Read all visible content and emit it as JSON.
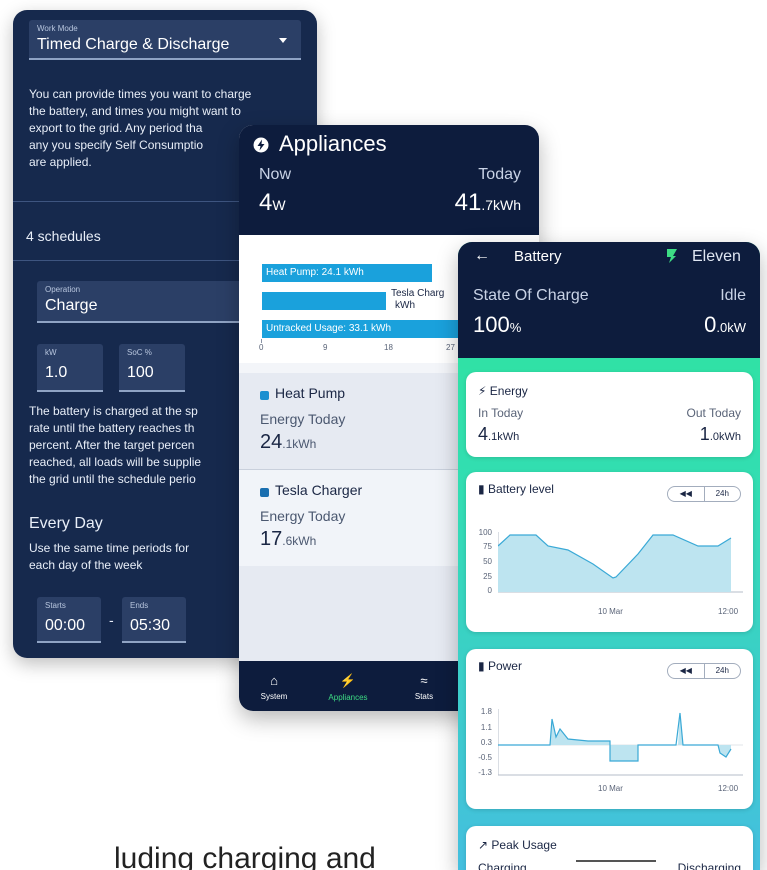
{
  "work_mode": {
    "mode_label": "Work Mode",
    "mode_value": "Timed Charge & Discharge",
    "description_lines": [
      "You can provide times you want to charge",
      "the battery, and times you might want to",
      "export to the grid. Any period tha",
      "any you specify Self Consumptio",
      "are applied."
    ],
    "schedules_count": "4 schedules",
    "operation_label": "Operation",
    "operation_value": "Charge",
    "kw_label": "kW",
    "kw_value": "1.0",
    "soc_label": "SoC %",
    "soc_value": "100",
    "info_lines": [
      "The battery is charged at the sp",
      "rate until the battery reaches th",
      "percent. After the target percen",
      "reached, all loads will be supplie",
      "the grid until the schedule perio"
    ],
    "every_day_title": "Every Day",
    "every_day_lines": [
      "Use the same time periods for",
      "each day of the week"
    ],
    "starts_label": "Starts",
    "starts_value": "00:00",
    "dash": "-",
    "ends_label": "Ends",
    "ends_value": "05:30"
  },
  "appliances": {
    "title": "Appliances",
    "now_label": "Now",
    "today_label": "Today",
    "now_value": "4",
    "now_unit": "W",
    "today_value": "41",
    "today_decimal": ".7",
    "today_unit": "kWh",
    "chart_labels": {
      "heat_pump": "Heat Pump: 24.1 kWh",
      "tesla_line1": "Tesla Charg",
      "tesla_line2": "kWh",
      "untracked": "Untracked Usage: 33.1 kWh"
    },
    "chart_ticks": [
      "0",
      "9",
      "18",
      "27"
    ],
    "chart_values_kwh": {
      "heat_pump": 24.1,
      "tesla": 17.6,
      "untracked": 33.1
    },
    "cards": [
      {
        "name": "Heat Pump",
        "sub": "Energy Today",
        "value": "24",
        "decimal": ".1",
        "unit": "kWh"
      },
      {
        "name": "Tesla Charger",
        "sub": "Energy Today",
        "value": "17",
        "decimal": ".6",
        "unit": "kWh"
      }
    ],
    "nav": [
      {
        "label": "System",
        "icon": "home-icon"
      },
      {
        "label": "Appliances",
        "icon": "bolt-icon"
      },
      {
        "label": "Stats",
        "icon": "stats-icon"
      }
    ]
  },
  "battery": {
    "title": "Battery",
    "brand": "Eleven",
    "soc_label": "State Of Charge",
    "status": "Idle",
    "soc_value": "100",
    "soc_unit": "%",
    "power_value": "0",
    "power_decimal": ".0",
    "power_unit": "kW",
    "energy_title": "Energy",
    "in_label": "In Today",
    "out_label": "Out Today",
    "in_value": "4",
    "in_decimal": ".1",
    "in_unit": "kWh",
    "out_value": "1",
    "out_decimal": ".0",
    "out_unit": "kWh",
    "level_title": "Battery level",
    "power_title": "Power",
    "range_button": "24h",
    "level_yticks": [
      "100",
      "75",
      "50",
      "25",
      "0"
    ],
    "power_yticks": [
      "1.8",
      "1.1",
      "0.3",
      "-0.5",
      "-1.3"
    ],
    "xticks": [
      "10 Mar",
      "12:00"
    ],
    "peak_title": "Peak Usage",
    "peak_charging": "Charging",
    "peak_discharging": "Discharging"
  },
  "caption": "luding charging and",
  "colors": {
    "navy": "#16294d",
    "dark_navy": "#0d1c3d",
    "accent_blue": "#1aa1dc",
    "green": "#3ddc84"
  }
}
